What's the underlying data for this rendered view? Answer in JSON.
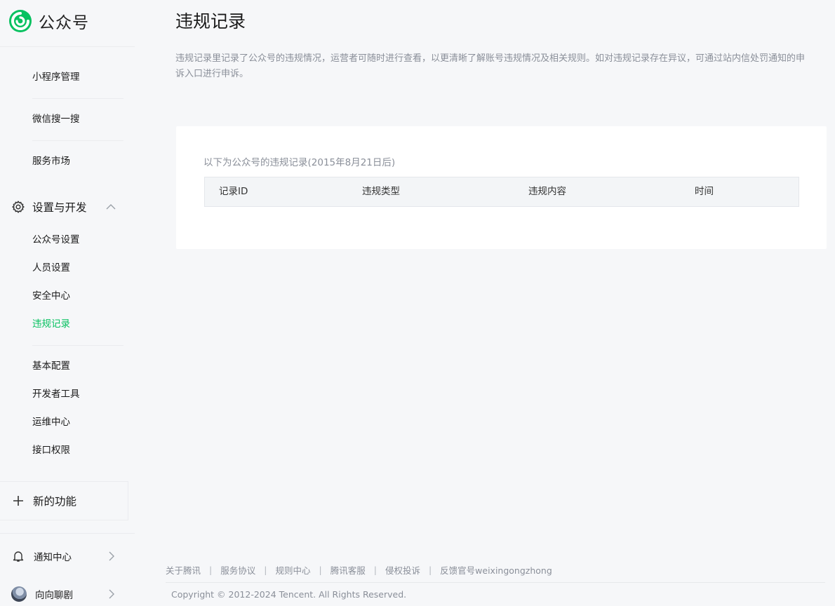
{
  "brand": {
    "name": "公众号",
    "logo_icon": "wechat-official-account-logo",
    "accent": "#07c160"
  },
  "sidebar": {
    "items_top": [
      {
        "label": "小程序管理"
      },
      {
        "label": "微信搜一搜"
      },
      {
        "label": "服务市场"
      }
    ],
    "section": {
      "label": "设置与开发",
      "icon": "gear-icon",
      "expanded": true
    },
    "section_items": [
      {
        "label": "公众号设置"
      },
      {
        "label": "人员设置"
      },
      {
        "label": "安全中心"
      },
      {
        "label": "违规记录",
        "active": true
      }
    ],
    "dev_items": [
      {
        "label": "基本配置"
      },
      {
        "label": "开发者工具"
      },
      {
        "label": "运维中心"
      },
      {
        "label": "接口权限"
      }
    ],
    "new_feature": {
      "label": "新的功能",
      "icon": "plus-icon"
    },
    "notifications": {
      "label": "通知中心",
      "icon": "bell-icon"
    },
    "account": {
      "label": "向向聊剧"
    }
  },
  "main": {
    "title": "违规记录",
    "description": "违规记录里记录了公众号的违规情况，运营者可随时进行查看，以更清晰了解账号违规情况及相关规则。如对违规记录存在异议，可通过站内信处罚通知的申诉入口进行申诉。",
    "caption": "以下为公众号的违规记录(2015年8月21日后)",
    "table_headers": [
      "记录ID",
      "违规类型",
      "违规内容",
      "时间"
    ]
  },
  "footer": {
    "links": [
      "关于腾讯",
      "服务协议",
      "规则中心",
      "腾讯客服",
      "侵权投诉",
      "反馈官号weixingongzhong"
    ],
    "separator": "|",
    "copyright": "Copyright © 2012-2024 Tencent. All Rights Reserved."
  }
}
